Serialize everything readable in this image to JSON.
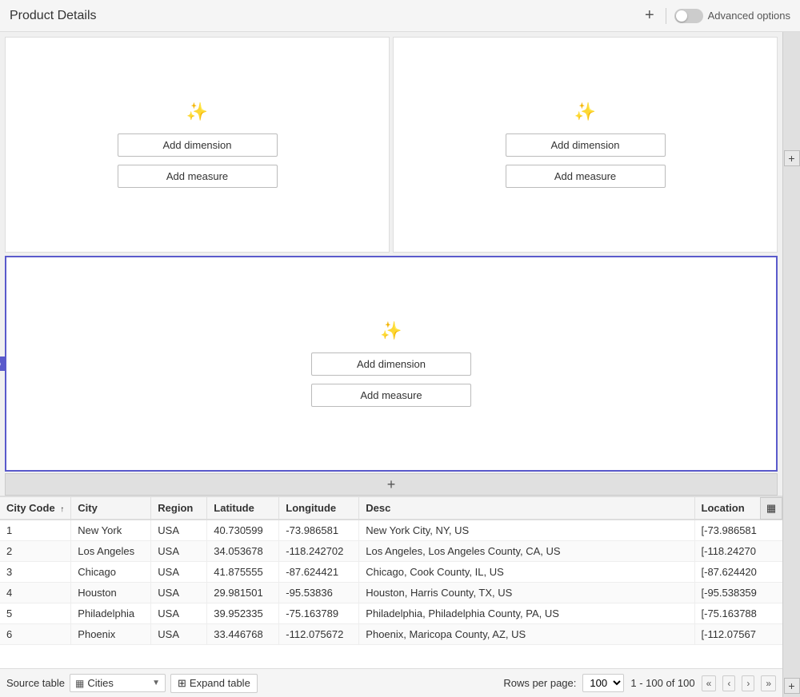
{
  "header": {
    "title": "Product Details",
    "add_label": "+",
    "advanced_options_label": "Advanced options"
  },
  "toolbar": {
    "add_button": "+",
    "grid_icon": "▦"
  },
  "panels": {
    "top_left": {
      "icon": "✏️",
      "add_dimension_label": "Add dimension",
      "add_measure_label": "Add measure"
    },
    "top_right": {
      "icon": "✏️",
      "add_dimension_label": "Add dimension",
      "add_measure_label": "Add measure"
    },
    "bottom": {
      "icon": "✏️",
      "add_dimension_label": "Add dimension",
      "add_measure_label": "Add measure"
    }
  },
  "right_buttons": {
    "plus1": "+",
    "plus2": "+"
  },
  "add_row": {
    "label": "+"
  },
  "table": {
    "columns": [
      {
        "key": "city_code",
        "label": "City Code",
        "sortable": true,
        "sort": "asc"
      },
      {
        "key": "city",
        "label": "City",
        "sortable": false
      },
      {
        "key": "region",
        "label": "Region",
        "sortable": false
      },
      {
        "key": "latitude",
        "label": "Latitude",
        "sortable": false
      },
      {
        "key": "longitude",
        "label": "Longitude",
        "sortable": false
      },
      {
        "key": "desc",
        "label": "Desc",
        "sortable": false
      },
      {
        "key": "location",
        "label": "Location",
        "sortable": false
      }
    ],
    "rows": [
      {
        "city_code": "1",
        "city": "New York",
        "region": "USA",
        "latitude": "40.730599",
        "longitude": "-73.986581",
        "desc": "New York City, NY, US",
        "location": "[-73.986581"
      },
      {
        "city_code": "2",
        "city": "Los Angeles",
        "region": "USA",
        "latitude": "34.053678",
        "longitude": "-118.242702",
        "desc": "Los Angeles, Los Angeles County, CA, US",
        "location": "[-118.24270"
      },
      {
        "city_code": "3",
        "city": "Chicago",
        "region": "USA",
        "latitude": "41.875555",
        "longitude": "-87.624421",
        "desc": "Chicago, Cook County, IL, US",
        "location": "[-87.624420"
      },
      {
        "city_code": "4",
        "city": "Houston",
        "region": "USA",
        "latitude": "29.981501",
        "longitude": "-95.53836",
        "desc": "Houston, Harris County, TX, US",
        "location": "[-95.538359"
      },
      {
        "city_code": "5",
        "city": "Philadelphia",
        "region": "USA",
        "latitude": "39.952335",
        "longitude": "-75.163789",
        "desc": "Philadelphia, Philadelphia County, PA, US",
        "location": "[-75.163788"
      },
      {
        "city_code": "6",
        "city": "Phoenix",
        "region": "USA",
        "latitude": "33.446768",
        "longitude": "-112.075672",
        "desc": "Phoenix, Maricopa County, AZ, US",
        "location": "[-112.07567"
      }
    ]
  },
  "footer": {
    "source_label": "Source table",
    "table_icon": "▦",
    "table_name": "Cities",
    "expand_icon": "⊞",
    "expand_label": "Expand table",
    "rows_per_page_label": "Rows per page:",
    "rows_per_page_value": "100",
    "page_info": "1 - 100 of 100",
    "nav_first": "«",
    "nav_prev": "‹",
    "nav_next": "›",
    "nav_last": "»"
  }
}
